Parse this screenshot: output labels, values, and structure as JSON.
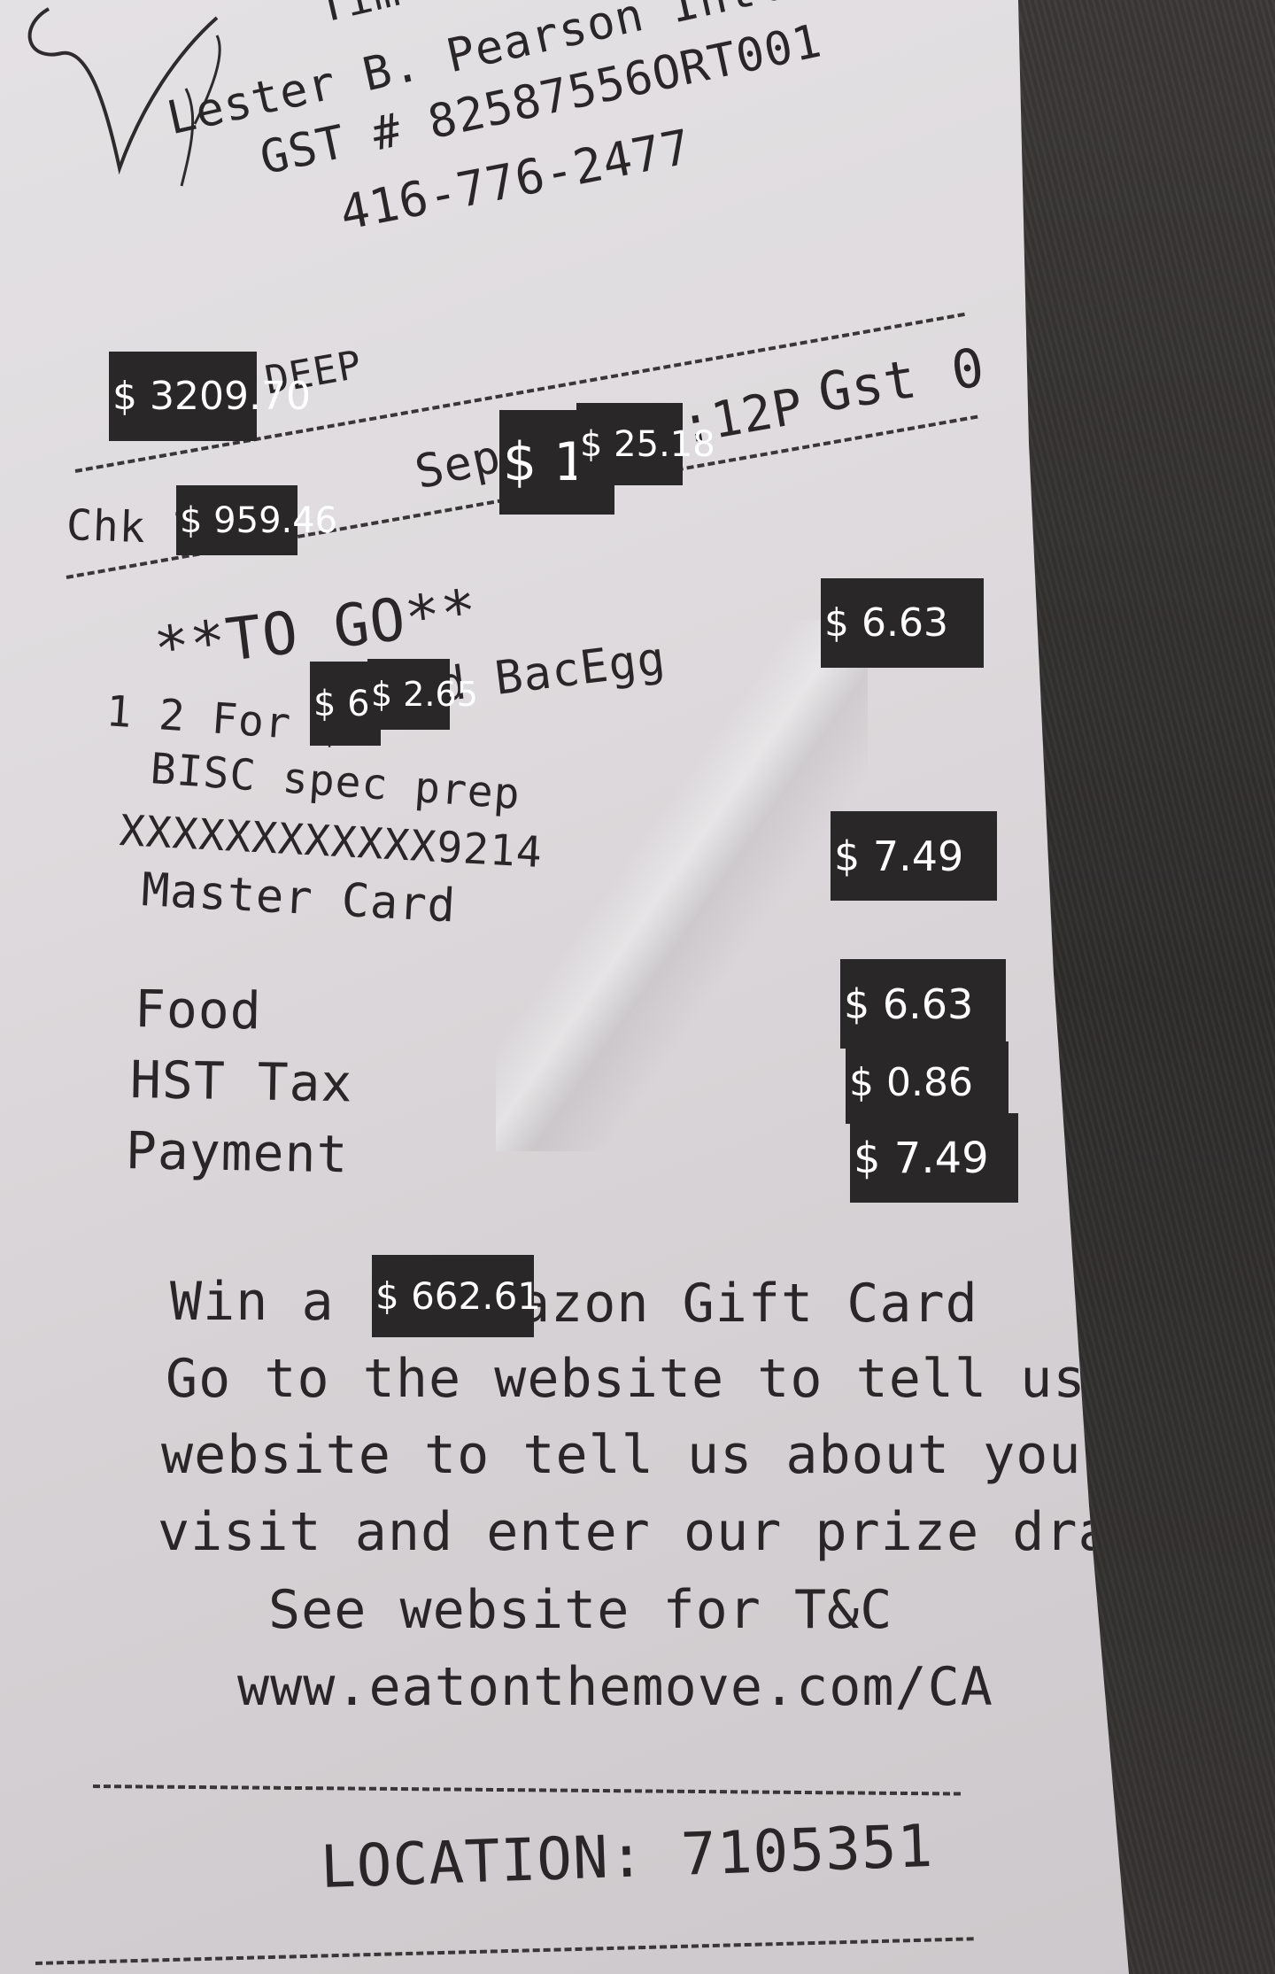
{
  "receipt": {
    "header": {
      "store_partial": "Tim Ho",
      "airport": "Lester B. Pearson Intl A",
      "gst_number": "GST # 82587556ORT001",
      "phone": "416-776-2477"
    },
    "server_fragment": "DEEP",
    "check": "Chk 7",
    "date_fragment": "Sep 1",
    "time_fragment": ":12P",
    "gst_label": "Gst",
    "gst_value": "0",
    "order_type": "**TO GO**",
    "item_line": "1 2 For $",
    "item_suffix": "d BacEgg",
    "item_modifier": "BISC spec prep",
    "card_number": "XXXXXXXXXXXX9214",
    "card_type": "Master Card",
    "totals": {
      "food_label": "Food",
      "tax_label": "HST Tax",
      "payment_label": "Payment"
    },
    "promo": {
      "line1_start": "Win a",
      "line1_end": "azon Gift Card",
      "line2": "Go to the website to tell us",
      "line3": "website to tell us about your",
      "line4": "visit and enter our prize draw",
      "line5": "See website for T&C",
      "line6": "www.eatonthemove.com/CA"
    },
    "location": "LOCATION: 7105351"
  },
  "overlays": [
    {
      "name": "amount-overlay-1",
      "text": "$ 3209.70"
    },
    {
      "name": "amount-overlay-2",
      "text": "$ 1"
    },
    {
      "name": "amount-overlay-3",
      "text": "$ 25.18"
    },
    {
      "name": "amount-overlay-4",
      "text": "$ 959.46"
    },
    {
      "name": "amount-overlay-5",
      "text": "$ 6.63"
    },
    {
      "name": "amount-overlay-6",
      "text": "$ 6"
    },
    {
      "name": "amount-overlay-7",
      "text": "$ 2.65"
    },
    {
      "name": "amount-overlay-8",
      "text": "$ 7.49"
    },
    {
      "name": "amount-overlay-9",
      "text": "$ 6.63"
    },
    {
      "name": "amount-overlay-10",
      "text": "$ 0.86"
    },
    {
      "name": "amount-overlay-11",
      "text": "$ 7.49"
    },
    {
      "name": "amount-overlay-12",
      "text": "$ 662.61"
    }
  ]
}
